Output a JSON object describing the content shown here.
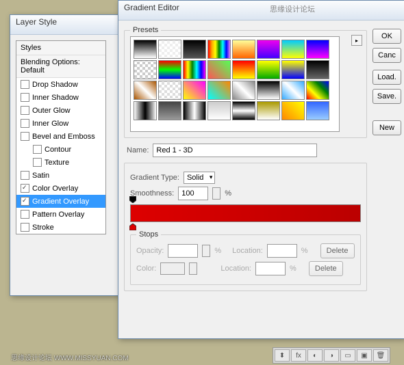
{
  "layerStyle": {
    "title": "Layer Style",
    "stylesHeader": "Styles",
    "blendingHeader": "Blending Options: Default",
    "items": [
      {
        "label": "Drop Shadow",
        "checked": false,
        "sub": false
      },
      {
        "label": "Inner Shadow",
        "checked": false,
        "sub": false
      },
      {
        "label": "Outer Glow",
        "checked": false,
        "sub": false
      },
      {
        "label": "Inner Glow",
        "checked": false,
        "sub": false
      },
      {
        "label": "Bevel and Emboss",
        "checked": false,
        "sub": false
      },
      {
        "label": "Contour",
        "checked": false,
        "sub": true
      },
      {
        "label": "Texture",
        "checked": false,
        "sub": true
      },
      {
        "label": "Satin",
        "checked": false,
        "sub": false
      },
      {
        "label": "Color Overlay",
        "checked": true,
        "sub": false
      },
      {
        "label": "Gradient Overlay",
        "checked": true,
        "sub": false,
        "selected": true
      },
      {
        "label": "Pattern Overlay",
        "checked": false,
        "sub": false
      },
      {
        "label": "Stroke",
        "checked": false,
        "sub": false
      }
    ]
  },
  "gradEditor": {
    "title": "Gradient Editor",
    "presetsLabel": "Presets",
    "nameLabel": "Name:",
    "nameValue": "Red 1 - 3D",
    "typeLabel": "Gradient Type:",
    "typeValue": "Solid",
    "smoothLabel": "Smoothness:",
    "smoothValue": "100",
    "percent": "%",
    "stopsLabel": "Stops",
    "opacityLabel": "Opacity:",
    "colorLabel": "Color:",
    "locationLabel": "Location:",
    "deleteLabel": "Delete",
    "buttons": {
      "ok": "OK",
      "cancel": "Canc",
      "load": "Load.",
      "save": "Save.",
      "new": "New"
    },
    "presetSwatches": [
      "linear-gradient(#000,#fff)",
      "repeating-conic-gradient(#eee 0 25%,#fff 0 50%) 0/8px 8px",
      "linear-gradient(#000,#555)",
      "linear-gradient(90deg,red,orange,yellow,green,cyan,blue,violet)",
      "linear-gradient(#ff9,#f60)",
      "linear-gradient(#e0e,#40f)",
      "linear-gradient(#0cf,#ff0)",
      "linear-gradient(#00f,#f0f)",
      "repeating-conic-gradient(#ccc 0 25%,#fff 0 50%) 0/8px 8px",
      "linear-gradient(#f00,#0f0,#00f)",
      "linear-gradient(90deg,red,yellow,green,cyan,blue,magenta)",
      "linear-gradient(45deg,#f55,#5f5)",
      "linear-gradient(#f00,#ff0)",
      "linear-gradient(#ff0,#0a0)",
      "linear-gradient(#ff0,#00f)",
      "linear-gradient(#000,#666)",
      "linear-gradient(45deg,#a50,#fff,#a50)",
      "repeating-conic-gradient(#ddd 0 25%,#fff 0 50%) 0/8px 8px",
      "linear-gradient(45deg,#ff0,#f0f)",
      "linear-gradient(45deg,#0ff,#f80)",
      "linear-gradient(45deg,#888,#fff,#888)",
      "linear-gradient(#000,#fff)",
      "linear-gradient(45deg,#3af,#fff,#3af)",
      "linear-gradient(45deg,red,yellow,green,blue)",
      "linear-gradient(90deg,#fff,#000,#fff)",
      "linear-gradient(#444,#999)",
      "linear-gradient(90deg,#000,#fff,#000)",
      "linear-gradient(#ccc,#fff)",
      "linear-gradient(#000,#fff,#000)",
      "linear-gradient(#a90,#fff)",
      "linear-gradient(45deg,#f80,#ff0)",
      "linear-gradient(#36f,#9cf)"
    ]
  },
  "watermark": "思缘设计论坛 WWW.MISSYUAN.COM",
  "watermark2": "思缘设计论坛"
}
